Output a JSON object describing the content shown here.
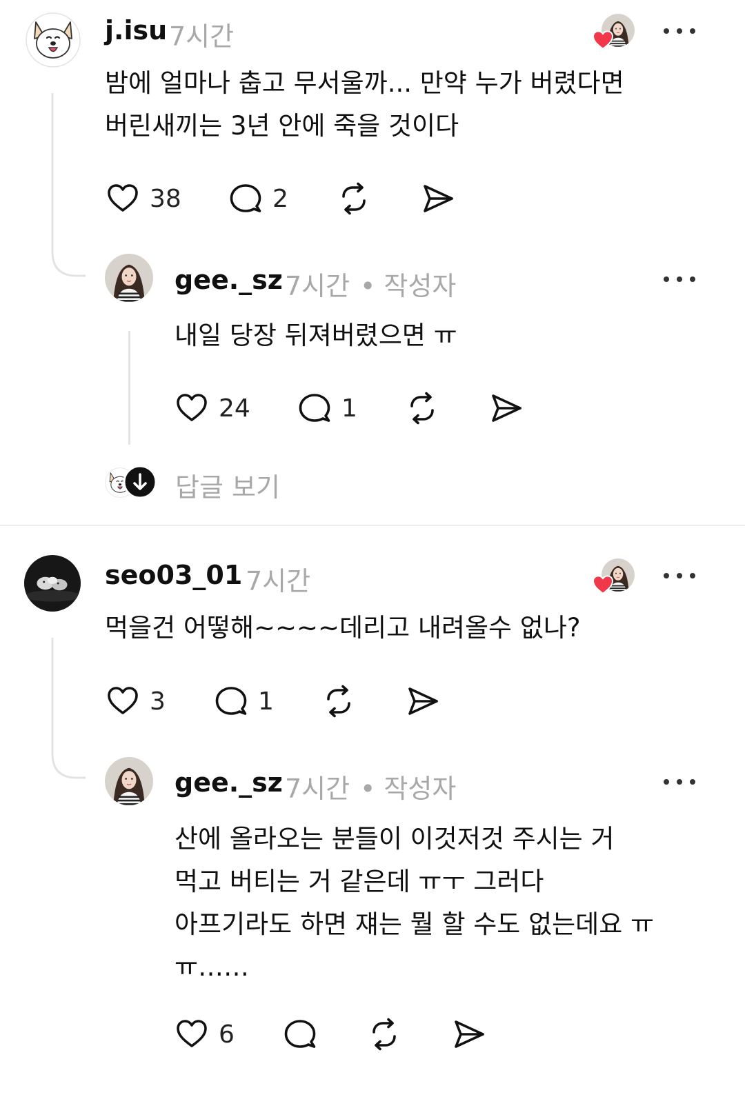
{
  "comments": [
    {
      "username": "j.isu",
      "time": "7시간",
      "lines": [
        "밤에 얼마나 춥고 무서울까... 만약 누가 버렸다면",
        "버린새끼는 3년 안에 죽을 것이다"
      ],
      "likes": "38",
      "replies": "2",
      "reply": {
        "username": "gee._sz",
        "time": "7시간",
        "author_tag": "• 작성자",
        "lines": [
          "내일 당장 뒤져버렸으면 ㅠ"
        ],
        "likes": "24",
        "replies": "1"
      },
      "view_replies": "답글 보기"
    },
    {
      "username": "seo03_01",
      "time": "7시간",
      "lines": [
        "먹을건 어떻해~~~~데리고 내려올수 없나?"
      ],
      "likes": "3",
      "replies": "1",
      "reply": {
        "username": "gee._sz",
        "time": "7시간",
        "author_tag": "• 작성자",
        "lines": [
          "산에 올라오는 분들이 이것저것 주시는 거",
          "먹고 버티는 거 같은데 ㅠㅜ 그러다",
          "아프기라도 하면 쟤는 뭘 할 수도 없는데요 ㅠ",
          "ㅠ……"
        ],
        "likes": "6",
        "replies": ""
      }
    }
  ],
  "icons": {
    "like": "heart-outline-icon",
    "comment": "comment-bubble-icon",
    "repost": "repost-icon",
    "share": "send-icon",
    "more": "more-dots-icon",
    "liked_by_author": "red-heart-badge-icon",
    "view_replies": "arrow-down-circle-icon"
  },
  "colors": {
    "liked_heart": "#f0384a",
    "meta_gray": "#a8a8a8",
    "text": "#101010"
  }
}
